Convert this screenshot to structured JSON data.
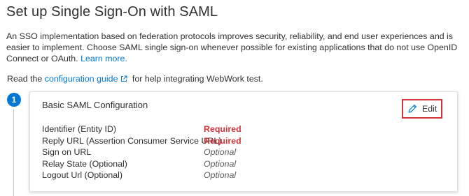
{
  "header": {
    "title": "Set up Single Sign-On with SAML"
  },
  "intro": {
    "text": "An SSO implementation based on federation protocols improves security, reliability, and end user experiences and is easier to implement. Choose SAML single sign-on whenever possible for existing applications that do not use OpenID Connect or OAuth.",
    "learn_more": "Learn more."
  },
  "guide": {
    "prefix": "Read the",
    "link": "configuration guide",
    "suffix": "for help integrating WebWork test."
  },
  "step": {
    "number": "1",
    "card_title": "Basic SAML Configuration",
    "edit_label": "Edit",
    "fields": [
      {
        "name": "Identifier (Entity ID)",
        "value": "Required",
        "status": "required"
      },
      {
        "name": "Reply URL (Assertion Consumer Service URL)",
        "value": "Required",
        "status": "required"
      },
      {
        "name": "Sign on URL",
        "value": "Optional",
        "status": "optional"
      },
      {
        "name": "Relay State (Optional)",
        "value": "Optional",
        "status": "optional"
      },
      {
        "name": "Logout Url (Optional)",
        "value": "Optional",
        "status": "optional"
      }
    ]
  },
  "icons": {
    "external_link": "external-link-icon",
    "edit": "pencil-icon"
  },
  "colors": {
    "accent": "#0078d4",
    "required": "#d13438",
    "highlight_border": "#d13438",
    "optional": "#605e5c"
  }
}
